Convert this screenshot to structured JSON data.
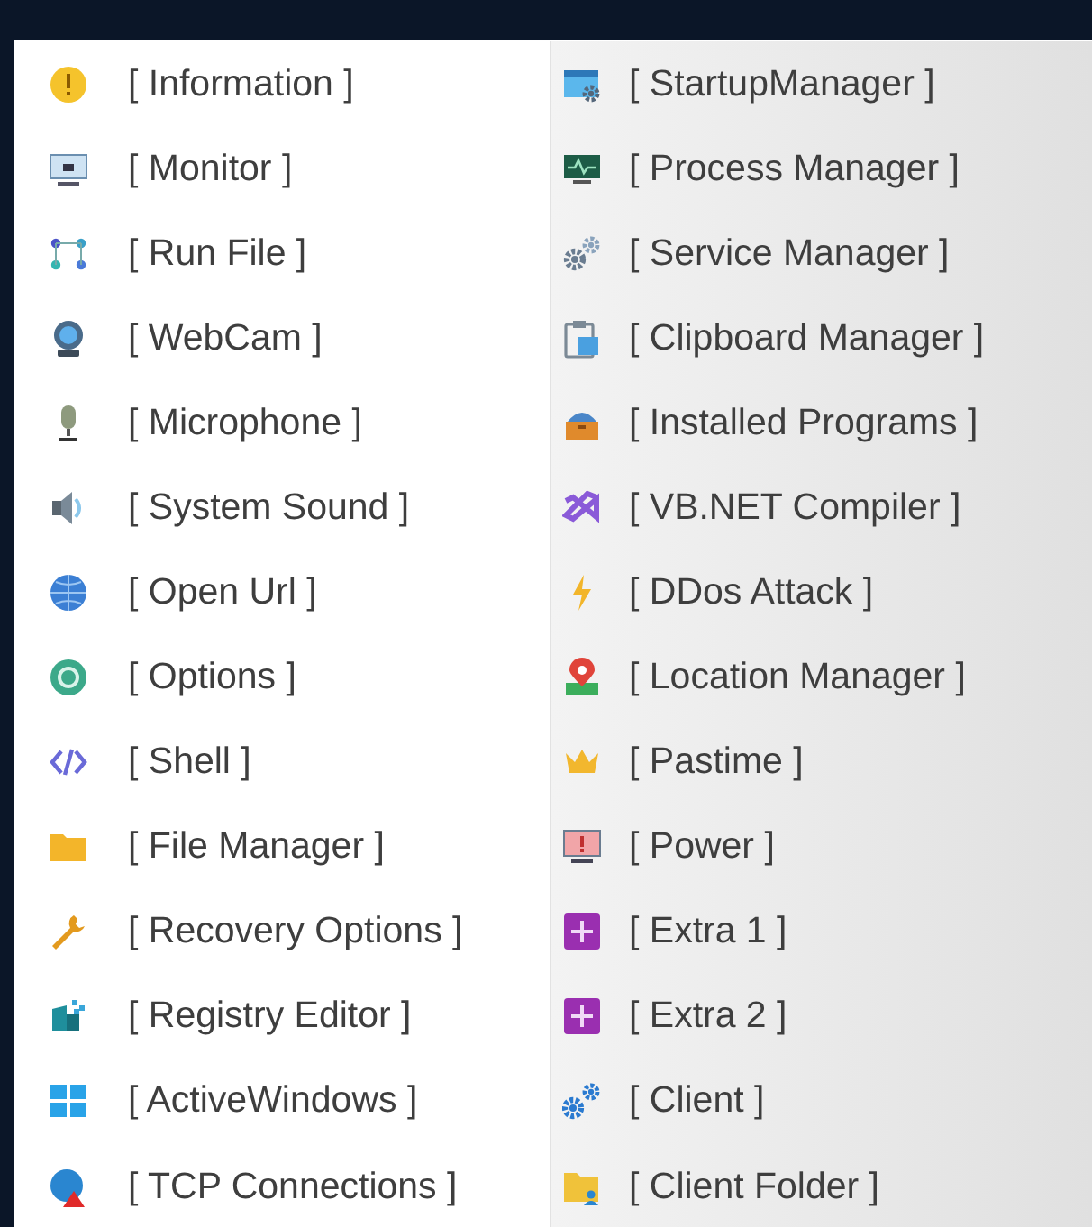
{
  "menu": {
    "columns": [
      {
        "items": [
          {
            "label": "[ Information ]"
          },
          {
            "label": "[ Monitor ]"
          },
          {
            "label": "[ Run File ]"
          },
          {
            "label": "[ WebCam ]"
          },
          {
            "label": "[ Microphone ]"
          },
          {
            "label": "[ System Sound ]"
          },
          {
            "label": "[ Open Url ]"
          },
          {
            "label": "[ Options ]"
          },
          {
            "label": "[ Shell ]"
          },
          {
            "label": "[ File Manager ]"
          },
          {
            "label": "[ Recovery Options ]"
          },
          {
            "label": "[ Registry Editor ]"
          },
          {
            "label": "[ ActiveWindows ]"
          },
          {
            "label": "[ TCP Connections ]"
          }
        ]
      },
      {
        "items": [
          {
            "label": "[ StartupManager ]"
          },
          {
            "label": "[ Process Manager ]"
          },
          {
            "label": "[ Service Manager ]"
          },
          {
            "label": "[ Clipboard Manager ]"
          },
          {
            "label": "[ Installed Programs ]"
          },
          {
            "label": "[ VB.NET Compiler ]"
          },
          {
            "label": "[ DDos Attack ]"
          },
          {
            "label": "[ Location Manager ]"
          },
          {
            "label": "[ Pastime ]"
          },
          {
            "label": "[ Power ]"
          },
          {
            "label": "[ Extra 1 ]"
          },
          {
            "label": "[ Extra 2 ]"
          },
          {
            "label": "[ Client ]"
          },
          {
            "label": "[ Client Folder ]"
          }
        ]
      }
    ]
  }
}
